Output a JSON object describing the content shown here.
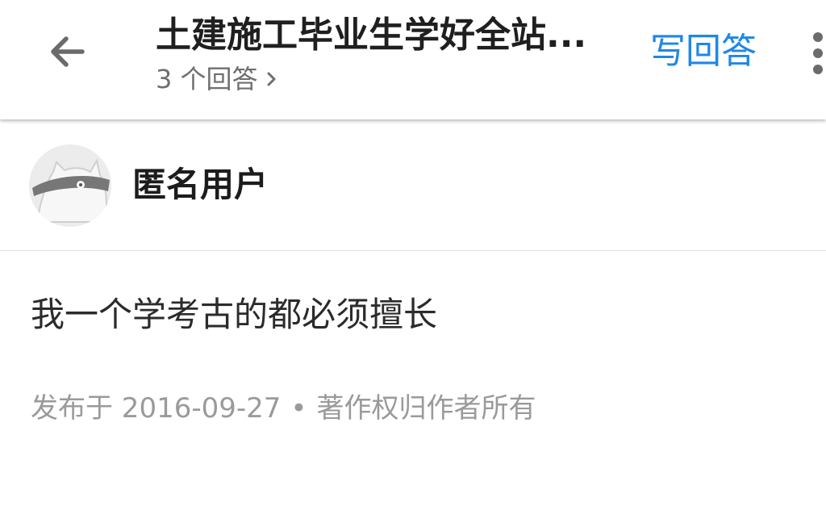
{
  "header": {
    "title": "土建施工毕业生学好全站...",
    "answer_count": "3 个回答",
    "write_answer": "写回答"
  },
  "author": {
    "name": "匿名用户"
  },
  "answer": {
    "content": "我一个学考古的都必须擅长"
  },
  "meta": {
    "published": "发布于 2016-09-27",
    "separator": "•",
    "copyright": "著作权归作者所有"
  },
  "colors": {
    "accent": "#1e88e5",
    "title": "#1f1f1f",
    "secondary": "#6f6f6f",
    "meta": "#9a9a9a"
  },
  "icons": {
    "back": "arrow-left-icon",
    "chevron": "chevron-right-icon",
    "more": "more-vertical-icon",
    "avatar": "anonymous-avatar-icon"
  }
}
